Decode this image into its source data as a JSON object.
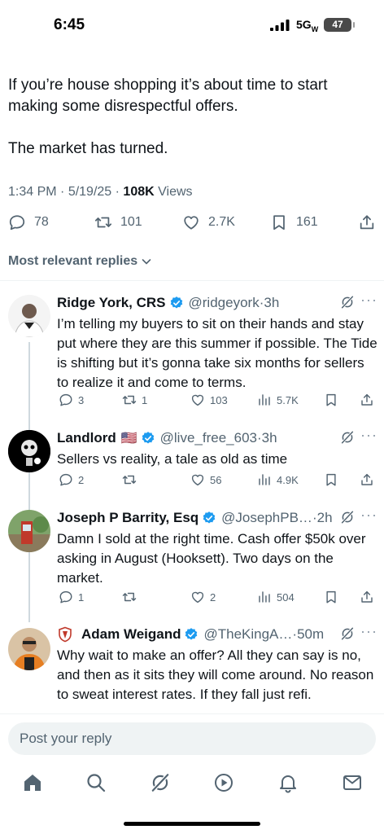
{
  "status_bar": {
    "time": "6:45",
    "network": "5G",
    "network_sub": "W",
    "battery": "47"
  },
  "tweet": {
    "paragraphs": [
      "If you’re house shopping it’s about time to start making some disrespectful offers.",
      "The market has turned."
    ],
    "meta": {
      "time": "1:34 PM",
      "date": "5/19/25",
      "views": "108K",
      "views_label": "Views"
    },
    "actions": {
      "replies": "78",
      "reposts": "101",
      "likes": "2.7K",
      "bookmarks": "161"
    }
  },
  "sort_label": "Most relevant replies",
  "replies": [
    {
      "name": "Ridge York, CRS",
      "handle": "@ridgeyork",
      "time": "3h",
      "verified": true,
      "text": "I’m telling my buyers to sit on their hands and stay put where they are this summer if possible. The Tide is shifting but it’s gonna take six months for sellers to realize it and come to terms.",
      "replies": "3",
      "reposts": "1",
      "likes": "103",
      "views": "5.7K"
    },
    {
      "name": "Landlord",
      "flag": "🇺🇸",
      "handle": "@live_free_603",
      "time": "3h",
      "verified": true,
      "text": "Sellers vs reality, a tale as old as time",
      "replies": "2",
      "reposts": "",
      "likes": "56",
      "views": "4.9K"
    },
    {
      "name": "Joseph P Barrity, Esq",
      "handle": "@JosephPB…",
      "time": "2h",
      "verified": true,
      "text": "Damn I sold at the right time.  Cash offer $50k over asking in August (Hooksett).  Two days on the market.",
      "replies": "1",
      "reposts": "",
      "likes": "2",
      "views": "504"
    },
    {
      "name": "Adam Weigand",
      "handle": "@TheKingA…",
      "time": "50m",
      "verified": true,
      "text": "Why wait to make an offer? All they can say is no, and then as it sits they will come around. No reason to sweat interest rates. If they fall just refi."
    }
  ],
  "composer": {
    "placeholder": "Post your reply"
  },
  "tabs": [
    "home-icon",
    "search-icon",
    "grok-icon",
    "video-icon",
    "notifications-icon",
    "messages-icon"
  ],
  "colors": {
    "accent": "#1d9bf0",
    "secondary_text": "#536471",
    "primary_text": "#0f1419"
  }
}
